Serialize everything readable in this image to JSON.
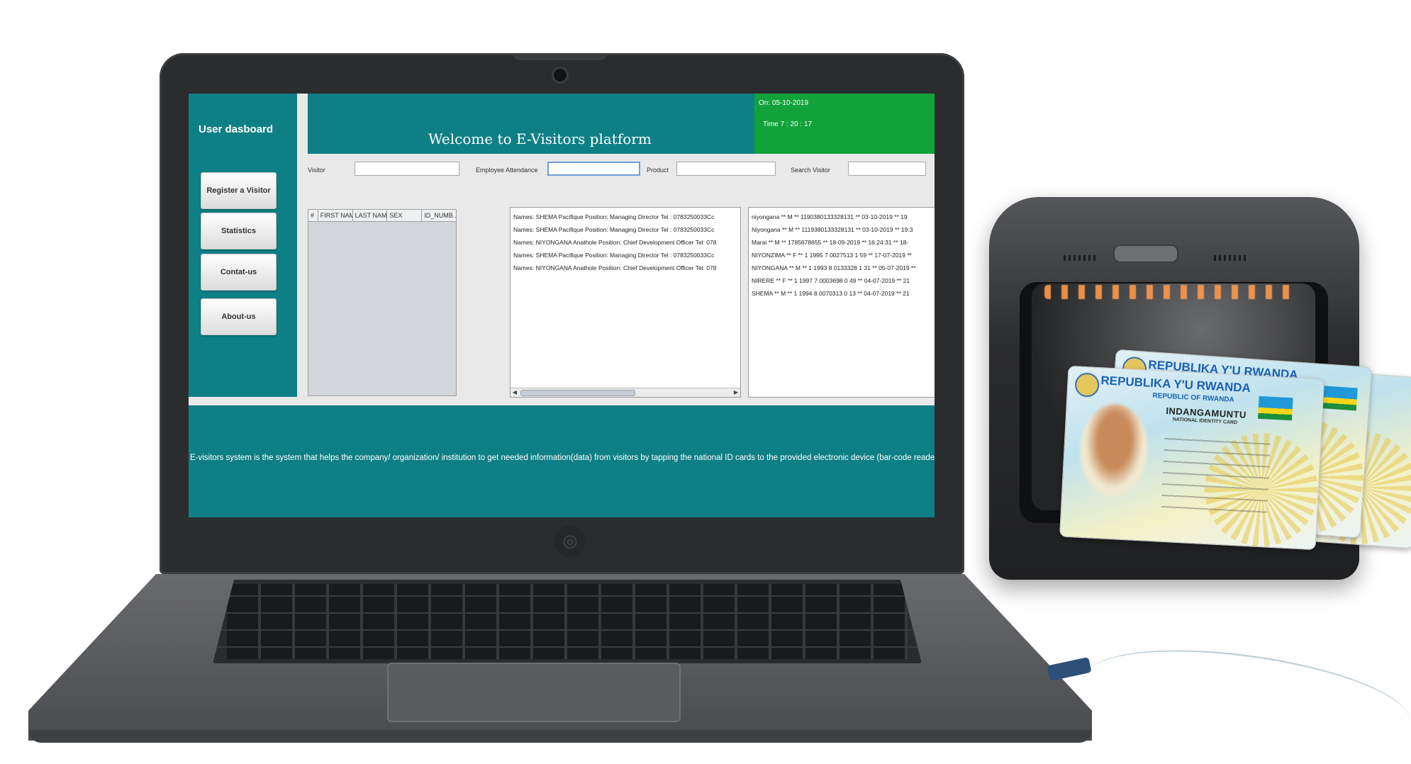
{
  "app": {
    "sidebar_title": "User dasboard",
    "welcome": "Welcome to E-Visitors platform",
    "date": "On: 05-10-2019",
    "time": "Time 7 : 20 : 17"
  },
  "sidebar": {
    "items": [
      {
        "label": "Register a Visitor"
      },
      {
        "label": "Statistics"
      },
      {
        "label": "Contat-us"
      },
      {
        "label": "About-us"
      }
    ]
  },
  "form": {
    "visitor_label": "Visitor",
    "attendance_label": "Employee Attendance",
    "product_label": "Product",
    "search_label": "Search Visitor"
  },
  "table": {
    "columns": [
      "#",
      "FIRST NAME",
      "LAST NAME",
      "SEX",
      "ID_NUMB..."
    ]
  },
  "employees": [
    "Names: SHEMA Pacifique Position: Managing Director Tel : 0783250033Cc",
    "Names: SHEMA Pacifique Position: Managing Director Tel : 0783250033Cc",
    "Names: NIYONGANA Anathole Position: Chief Development Officer Tel: 078",
    "Names: SHEMA Pacifique Position: Managing Director Tel : 0783250033Cc",
    "Names: NIYONGANA Anathole Position: Chief Development Officer Tel: 078"
  ],
  "records": [
    "niyongana ** M ** 1190380133328131 ** 03-10-2019 ** 19",
    "Niyongana ** M ** 1119380133328131 ** 03-10-2019 ** 19:3",
    "Marai ** M ** 1785678655 ** 18-09-2019 ** 16:24:31 ** 18-",
    "NIYONZIMA ** F ** 1 1995 7 0027513 1 59 ** 17-07-2019 **",
    "NIYONGANA ** M ** 1 1993 8 0133328 1 31 ** 05-07-2019 **",
    "NIRERE ** F ** 1 1997 7 0003698 0 49 ** 04-07-2019 ** 21",
    "SHEMA ** M ** 1 1994 8 0070313 0 13 ** 04-07-2019 ** 21"
  ],
  "footer": {
    "text": "E-visitors system is the system that helps  the company/ organization/ institution to get needed information(data) from visitors by tapping the national ID cards to the provided electronic device (bar-code reader)."
  },
  "id_card": {
    "header": "REPUBLIKA Y'U RWANDA",
    "sub": "REPUBLIC OF RWANDA",
    "title": "INDANGAMUNTU",
    "subtitle": "NATIONAL IDENTITY CARD"
  },
  "colors": {
    "teal": "#0f7f86",
    "green": "#11a33a"
  }
}
